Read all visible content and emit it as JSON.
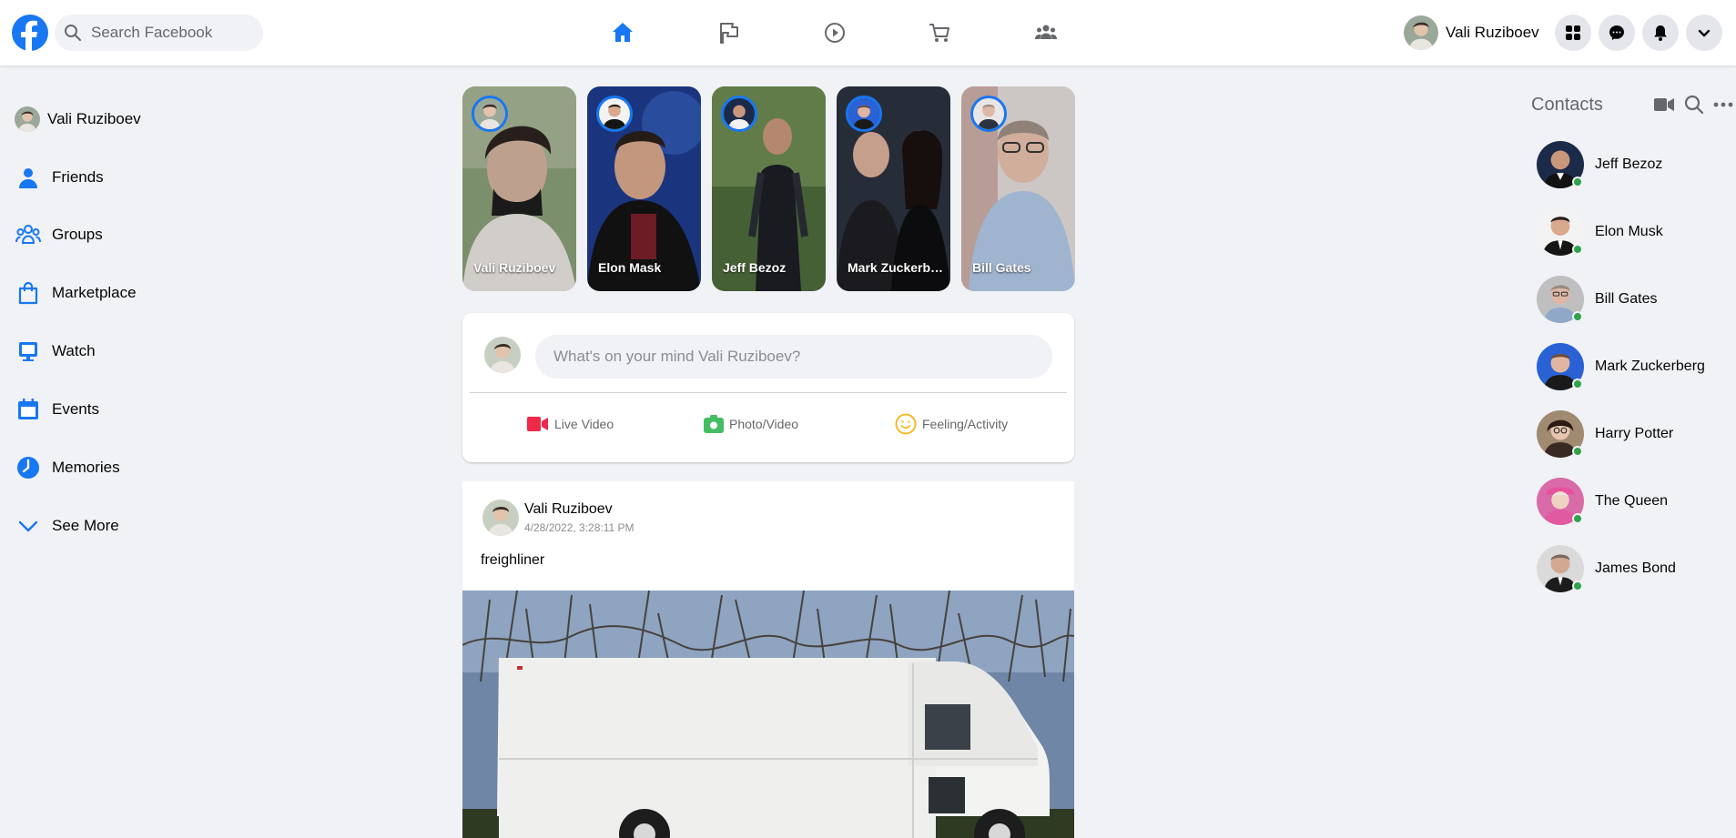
{
  "header": {
    "search_placeholder": "Search Facebook",
    "user_name": "Vali Ruziboev",
    "nav": [
      "home-icon",
      "flag-icon",
      "watch-icon",
      "marketplace-icon",
      "groups-icon"
    ],
    "accent": "#1877f2"
  },
  "sidebar": {
    "items": [
      {
        "label": "Vali Ruziboev",
        "icon": "avatar"
      },
      {
        "label": "Friends",
        "icon": "friends-icon"
      },
      {
        "label": "Groups",
        "icon": "groups-icon"
      },
      {
        "label": "Marketplace",
        "icon": "marketplace-icon"
      },
      {
        "label": "Watch",
        "icon": "watch-icon"
      },
      {
        "label": "Events",
        "icon": "events-icon"
      },
      {
        "label": "Memories",
        "icon": "memories-icon"
      },
      {
        "label": "See More",
        "icon": "chevron-down-icon"
      }
    ]
  },
  "stories": [
    {
      "name": "Vali Ruziboev"
    },
    {
      "name": "Elon Mask"
    },
    {
      "name": "Jeff Bezoz"
    },
    {
      "name": "Mark Zuckerberg"
    },
    {
      "name": "Bill Gates"
    }
  ],
  "composer": {
    "placeholder": "What's on your mind Vali Ruziboev?",
    "actions": [
      "Live Video",
      "Photo/Video",
      "Feeling/Activity"
    ]
  },
  "post": {
    "author": "Vali Ruziboev",
    "date": "4/28/2022, 3:28:11 PM",
    "text": "freighliner"
  },
  "contacts": {
    "title": "Contacts",
    "items": [
      {
        "name": "Jeff Bezoz"
      },
      {
        "name": "Elon Musk"
      },
      {
        "name": "Bill Gates"
      },
      {
        "name": "Mark Zuckerberg"
      },
      {
        "name": "Harry Potter"
      },
      {
        "name": "The Queen"
      },
      {
        "name": "James Bond"
      }
    ],
    "online_color": "#31a24c"
  }
}
